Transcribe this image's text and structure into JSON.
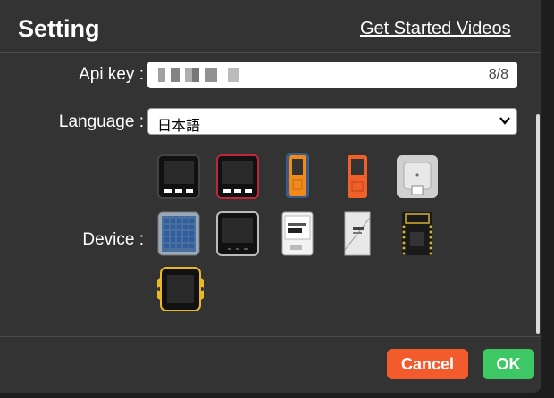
{
  "header": {
    "title": "Setting",
    "videos_link": "Get Started Videos"
  },
  "api_key": {
    "label": "Api key :",
    "counter": "8/8"
  },
  "language": {
    "label": "Language :",
    "selected": "日本語"
  },
  "device": {
    "label": "Device :",
    "items": [
      {
        "name": "core-black"
      },
      {
        "name": "core-red"
      },
      {
        "name": "stickc-orange-selected"
      },
      {
        "name": "stickc-orange"
      },
      {
        "name": "atom-echo-grey"
      },
      {
        "name": "atom-matrix"
      },
      {
        "name": "core2"
      },
      {
        "name": "coreink"
      },
      {
        "name": "paper"
      },
      {
        "name": "stamp-board"
      },
      {
        "name": "tough-yellow"
      }
    ]
  },
  "footer": {
    "cancel_label": "Cancel",
    "ok_label": "OK"
  },
  "colors": {
    "cancel": "#f35b2c",
    "ok": "#3ec865",
    "dialog_bg": "#333333"
  }
}
